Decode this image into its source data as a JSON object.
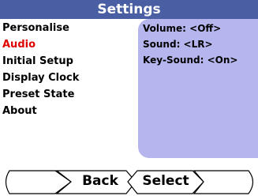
{
  "title": "Settings",
  "menu": {
    "items": [
      {
        "label": "Personalise",
        "selected": false
      },
      {
        "label": "Audio",
        "selected": true
      },
      {
        "label": "Initial Setup",
        "selected": false
      },
      {
        "label": "Display Clock",
        "selected": false
      },
      {
        "label": "Preset State",
        "selected": false
      },
      {
        "label": "About",
        "selected": false
      }
    ]
  },
  "details": {
    "lines": [
      "Volume: <Off>",
      "Sound: <LR>",
      "Key-Sound: <On>"
    ]
  },
  "softkeys": {
    "left_label": "",
    "back_label": "Back",
    "select_label": "Select",
    "right_label": ""
  },
  "colors": {
    "titlebar": "#4a5fa3",
    "panel": "#b6b6ee",
    "selected_text": "#e00000"
  }
}
